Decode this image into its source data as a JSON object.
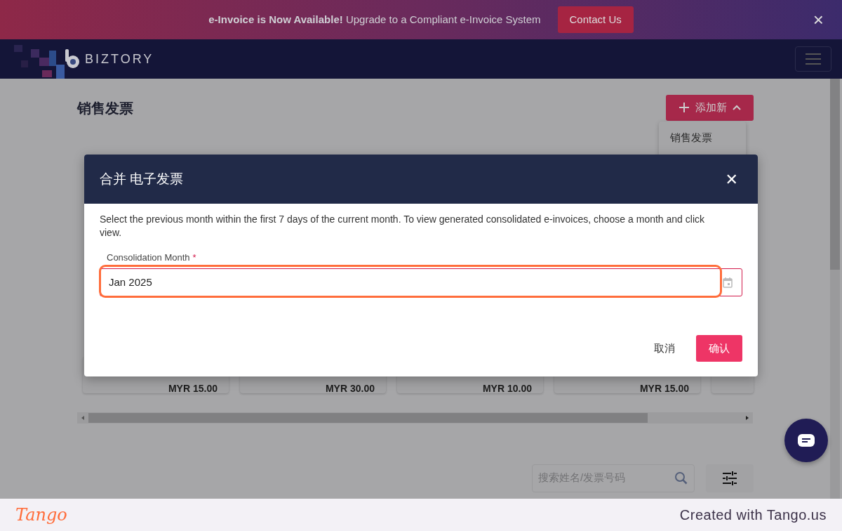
{
  "banner": {
    "message": "**e-Invoice is Now Available!** Upgrade to a Compliant e-Invoice System",
    "button": "Contact Us",
    "close": "×"
  },
  "navbar": {
    "brand": "BIZTORY"
  },
  "page": {
    "title": "销售发票",
    "add_button": "添加新",
    "add_menu": [
      "销售发票"
    ],
    "cards": [
      {
        "amount": "MYR 15.00"
      },
      {
        "amount": "MYR 30.00"
      },
      {
        "amount": "MYR 10.00"
      },
      {
        "amount": "MYR 15.00"
      }
    ],
    "search": {
      "placeholder": "搜索姓名/发票号码"
    }
  },
  "modal": {
    "title": "合并 电子发票",
    "close": "✕",
    "description": "Select the previous month within the first 7 days of the current month. To view generated consolidated e-invoices, choose a month and click view.",
    "field": {
      "label": "Consolidation Month",
      "required_mark": "*",
      "value": "Jan 2025"
    },
    "buttons": [
      {
        "label": "取消",
        "kind": "text"
      },
      {
        "label": "确认",
        "kind": "primary"
      }
    ]
  },
  "footer": {
    "logo": "Tango",
    "credit": "Created with Tango.us"
  }
}
